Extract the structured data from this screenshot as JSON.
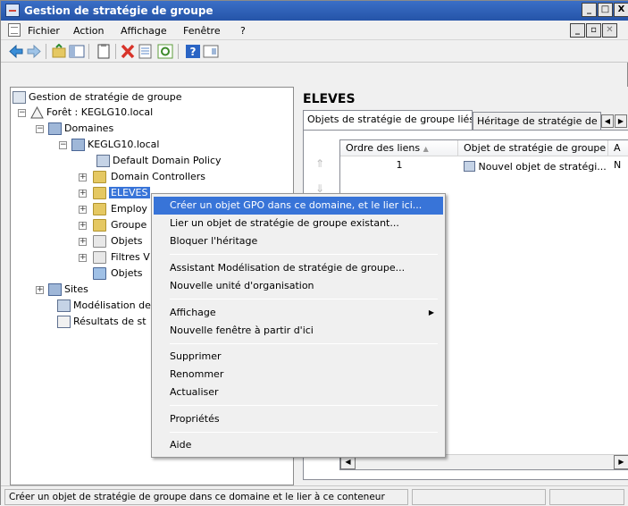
{
  "window": {
    "title": "Gestion de stratégie de groupe",
    "controls": {
      "minimize": "_",
      "maximize": "□",
      "close": "X"
    }
  },
  "menubar": {
    "items": [
      "Fichier",
      "Action",
      "Affichage",
      "Fenêtre",
      "?"
    ],
    "mdi_controls": {
      "minimize": "_",
      "restore": "▫",
      "close": "✕"
    }
  },
  "toolbar": {
    "buttons": [
      "back-icon",
      "forward-icon",
      "up-folder-icon",
      "show-hide-tree-icon",
      "properties-icon",
      "delete-icon",
      "export-list-icon",
      "refresh-icon",
      "help-icon",
      "console-icon"
    ]
  },
  "tree": {
    "root": "Gestion de stratégie de groupe",
    "forest": "Forêt : KEGLG10.local",
    "domains": "Domaines",
    "domain": "KEGLG10.local",
    "default_policy": "Default Domain Policy",
    "domain_controllers": "Domain Controllers",
    "eleves": "ELEVES",
    "employ": "Employ",
    "groupe": "Groupe",
    "objets1": "Objets",
    "filtres": "Filtres V",
    "objets2": "Objets",
    "sites": "Sites",
    "modelisation": "Modélisation de",
    "resultats": "Résultats de st"
  },
  "rightpane": {
    "title": "ELEVES",
    "tabs": [
      "Objets de stratégie de groupe liés",
      "Héritage de stratégie de"
    ],
    "columns": [
      "Ordre des liens",
      "Objet de stratégie de groupe",
      "A"
    ],
    "rows": [
      {
        "order": "1",
        "gpo": "Nouvel objet de stratégi...",
        "extra": "N"
      }
    ]
  },
  "context_menu": {
    "items": [
      "Créer un objet GPO dans ce domaine, et le lier ici...",
      "Lier un objet de stratégie de groupe existant...",
      "Bloquer l'héritage",
      "Assistant Modélisation de stratégie de groupe...",
      "Nouvelle unité d'organisation",
      "Affichage",
      "Nouvelle fenêtre à partir d'ici",
      "Supprimer",
      "Renommer",
      "Actualiser",
      "Propriétés",
      "Aide"
    ],
    "highlighted_index": 0,
    "submenu_arrow": "▶"
  },
  "statusbar": {
    "text": "Créer un objet de stratégie de groupe dans ce domaine et le lier à ce conteneur"
  },
  "colors": {
    "title_bar": "#2554a8",
    "selection": "#3874d8",
    "delete_red": "#d8342a"
  }
}
